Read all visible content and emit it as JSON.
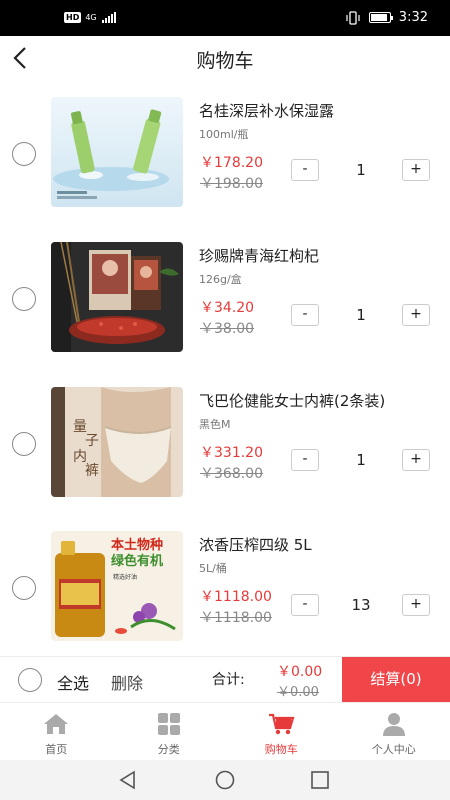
{
  "status_bar": {
    "hd": "HD",
    "network": "4G",
    "time": "3:32"
  },
  "header": {
    "title": "购物车"
  },
  "cart_items": [
    {
      "name": "名桂深层补水保湿露",
      "spec": "100ml/瓶",
      "price": "￥178.20",
      "original_price": "￥198.00",
      "quantity": "1",
      "image": "lotion-bottles"
    },
    {
      "name": "珍赐牌青海红枸杞",
      "spec": "126g/盒",
      "price": "￥34.20",
      "original_price": "￥38.00",
      "quantity": "1",
      "image": "goji-box"
    },
    {
      "name": "飞巴伦健能女士内裤(2条装)",
      "spec": "黑色M",
      "price": "￥331.20",
      "original_price": "￥368.00",
      "quantity": "1",
      "image": "underwear",
      "image_text": [
        "量",
        "子",
        "内",
        "裤"
      ]
    },
    {
      "name": "浓香压榨四级 5L",
      "spec": "5L/桶",
      "price": "￥1118.00",
      "original_price": "￥1118.00",
      "quantity": "13",
      "image": "oil-drum",
      "image_text": [
        "本土物种",
        "绿色有机",
        "精选好油"
      ]
    }
  ],
  "qty_controls": {
    "minus": "-",
    "plus": "+"
  },
  "summary": {
    "select_all": "全选",
    "delete": "删除",
    "total_label": "合计:",
    "total_price": "￥0.00",
    "total_original": "￥0.00",
    "checkout": "结算(0)"
  },
  "tabs": [
    {
      "label": "首页",
      "icon": "home-icon"
    },
    {
      "label": "分类",
      "icon": "category-icon"
    },
    {
      "label": "购物车",
      "icon": "cart-icon",
      "active": true
    },
    {
      "label": "个人中心",
      "icon": "user-icon"
    }
  ],
  "colors": {
    "accent": "#e63a3a",
    "checkout": "#f0464a",
    "inactive_tab": "#999999"
  }
}
